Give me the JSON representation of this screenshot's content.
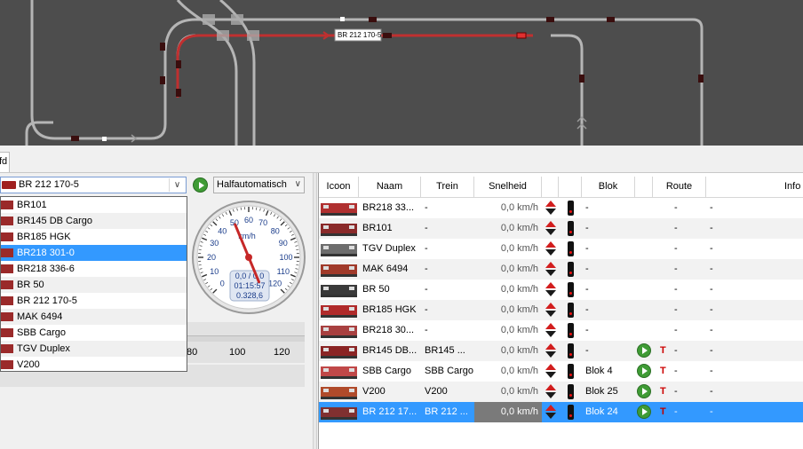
{
  "layout_label": "BR 212 170-5",
  "colors": {
    "track": "#b0b0b0",
    "route": "#c03030",
    "background": "#4d4d4d",
    "selection": "#3399ff"
  },
  "tab": {
    "label": "fd"
  },
  "loco_selector": {
    "selected": "BR 212 170-5"
  },
  "mode_selector": {
    "selected": "Halfautomatisch"
  },
  "dropdown_items": [
    "BR101",
    "BR145 DB Cargo",
    "BR185 HGK",
    "BR218 301-0",
    "BR218 336-6",
    "BR 50",
    "BR 212 170-5",
    "MAK 6494",
    "SBB Cargo",
    "TGV Duplex",
    "V200"
  ],
  "dropdown_selected_index": 3,
  "gauge": {
    "unit": "km/h",
    "ticks": [
      "0",
      "10",
      "20",
      "30",
      "40",
      "50",
      "60",
      "70",
      "80",
      "90",
      "100",
      "110",
      "120"
    ],
    "speed": "0,0 / 0,0",
    "time": "01:15:57",
    "distance": "0.328,6",
    "needle_kmh": 50
  },
  "slider": {
    "ticks": [
      "80",
      "100",
      "120"
    ]
  },
  "table": {
    "columns": [
      "Icoon",
      "Naam",
      "Trein",
      "Snelheid",
      "Blok",
      "Route",
      "Info"
    ],
    "rows": [
      {
        "naam": "BR218 33...",
        "trein": "-",
        "snelheid": "0,0 km/h",
        "blok": "-",
        "route_t": "",
        "route": "-",
        "info": "-",
        "play": false
      },
      {
        "naam": "BR101",
        "trein": "-",
        "snelheid": "0,0 km/h",
        "blok": "-",
        "route_t": "",
        "route": "-",
        "info": "-",
        "play": false
      },
      {
        "naam": "TGV Duplex",
        "trein": "-",
        "snelheid": "0,0 km/h",
        "blok": "-",
        "route_t": "",
        "route": "-",
        "info": "-",
        "play": false
      },
      {
        "naam": "MAK 6494",
        "trein": "-",
        "snelheid": "0,0 km/h",
        "blok": "-",
        "route_t": "",
        "route": "-",
        "info": "-",
        "play": false
      },
      {
        "naam": "BR 50",
        "trein": "-",
        "snelheid": "0,0 km/h",
        "blok": "-",
        "route_t": "",
        "route": "-",
        "info": "-",
        "play": false
      },
      {
        "naam": "BR185 HGK",
        "trein": "-",
        "snelheid": "0,0 km/h",
        "blok": "-",
        "route_t": "",
        "route": "-",
        "info": "-",
        "play": false
      },
      {
        "naam": "BR218 30...",
        "trein": "-",
        "snelheid": "0,0 km/h",
        "blok": "-",
        "route_t": "",
        "route": "-",
        "info": "-",
        "play": false
      },
      {
        "naam": "BR145 DB...",
        "trein": "BR145 ...",
        "snelheid": "0,0 km/h",
        "blok": "-",
        "route_t": "T",
        "route": "-",
        "info": "-",
        "play": true
      },
      {
        "naam": "SBB Cargo",
        "trein": "SBB Cargo",
        "snelheid": "0,0 km/h",
        "blok": "Blok 4",
        "route_t": "T",
        "route": "-",
        "info": "-",
        "play": true
      },
      {
        "naam": "V200",
        "trein": "V200",
        "snelheid": "0,0 km/h",
        "blok": "Blok 25",
        "route_t": "T",
        "route": "-",
        "info": "-",
        "play": true
      },
      {
        "naam": "BR 212 17...",
        "trein": "BR 212 ...",
        "snelheid": "0,0 km/h",
        "blok": "Blok 24",
        "route_t": "T",
        "route": "-",
        "info": "-",
        "play": true
      }
    ],
    "selected_row": 10
  }
}
